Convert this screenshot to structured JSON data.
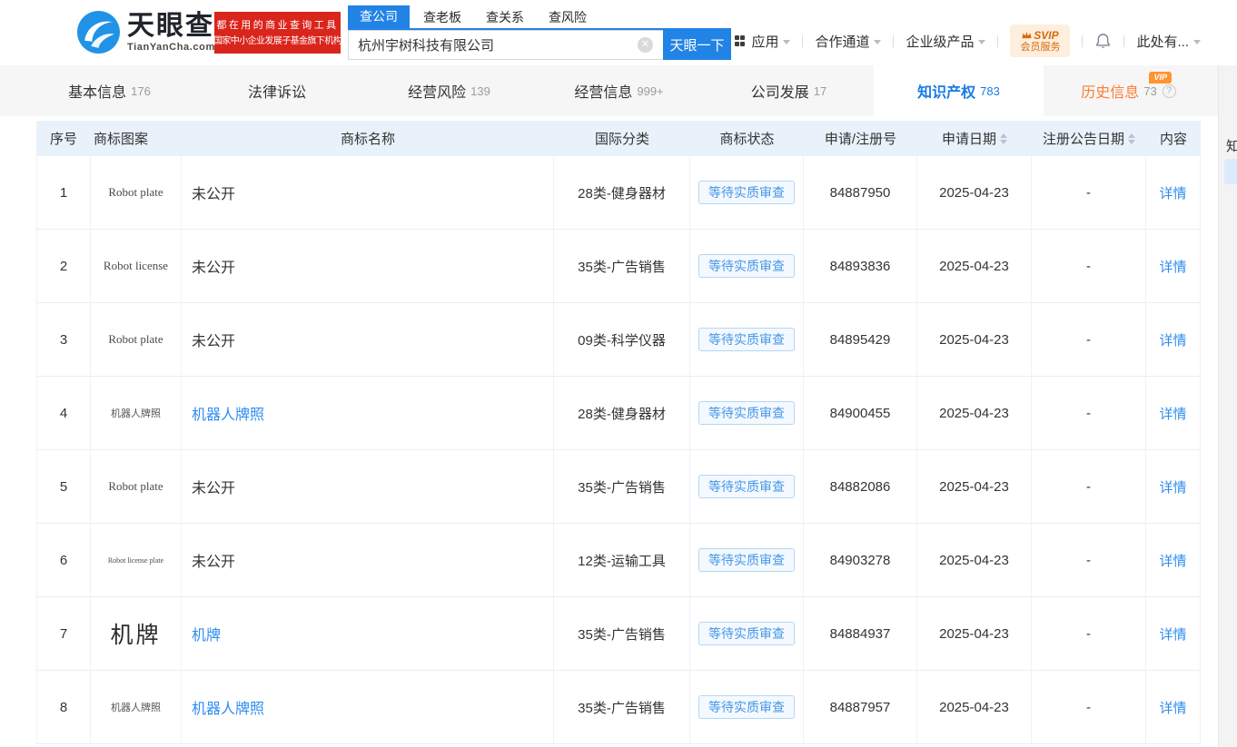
{
  "colors": {
    "brand_blue": "#2183e6",
    "link_blue": "#2d8cf0",
    "active_tab_blue": "#1a7be5",
    "promo_red": "#da251c",
    "vip_orange": "#ff9432",
    "history_orange": "#ff7c33",
    "table_header_bg": "#e9f2fb",
    "status_badge_blue": "#4796e8"
  },
  "header": {
    "logo": {
      "brand": "天眼查",
      "domain": "TianYanCha.com"
    },
    "promo": {
      "line1": "都在用的商业查询工具",
      "line2": "国家中小企业发展子基金旗下机构"
    },
    "search": {
      "tabs": [
        {
          "label": "查公司"
        },
        {
          "label": "查老板"
        },
        {
          "label": "查关系"
        },
        {
          "label": "查风险"
        }
      ],
      "active_tab": "查公司",
      "value": "杭州宇树科技有限公司",
      "button": "天眼一下"
    },
    "nav": {
      "apps": "应用",
      "partner": "合作通道",
      "enterprise": "企业级产品",
      "more": "此处有..."
    },
    "svip": {
      "top": "SVIP",
      "bottom": "会员服务"
    }
  },
  "vip_text": "VIP",
  "help_glyph": "?",
  "active_tab": "知识产权",
  "tabs": [
    {
      "label": "基本信息",
      "count": "176"
    },
    {
      "label": "法律诉讼",
      "count": ""
    },
    {
      "label": "经营风险",
      "count": "139"
    },
    {
      "label": "经营信息",
      "count": "999+"
    },
    {
      "label": "公司发展",
      "count": "17"
    },
    {
      "label": "知识产权",
      "count": "783"
    },
    {
      "label": "历史信息",
      "count": "73",
      "highlight": true,
      "vip": true,
      "help": true
    }
  ],
  "side_anchor": "知",
  "table": {
    "columns": [
      {
        "label": "序号"
      },
      {
        "label": "商标图案"
      },
      {
        "label": "商标名称"
      },
      {
        "label": "国际分类"
      },
      {
        "label": "商标状态"
      },
      {
        "label": "申请/注册号"
      },
      {
        "label": "申请日期",
        "sortable": true
      },
      {
        "label": "注册公告日期",
        "sortable": true
      },
      {
        "label": "内容"
      }
    ],
    "rows": [
      {
        "no": "1",
        "image": "Robot plate",
        "image_style": "latin",
        "name": "未公开",
        "name_is_link": false,
        "intl_class": "28类-健身器材",
        "status": "等待实质审查",
        "reg_no": "84887950",
        "apply_date": "2025-04-23",
        "pub_date": "-",
        "detail": "详情"
      },
      {
        "no": "2",
        "image": "Robot license",
        "image_style": "latin",
        "name": "未公开",
        "name_is_link": false,
        "intl_class": "35类-广告销售",
        "status": "等待实质审查",
        "reg_no": "84893836",
        "apply_date": "2025-04-23",
        "pub_date": "-",
        "detail": "详情"
      },
      {
        "no": "3",
        "image": "Robot plate",
        "image_style": "latin",
        "name": "未公开",
        "name_is_link": false,
        "intl_class": "09类-科学仪器",
        "status": "等待实质审查",
        "reg_no": "84895429",
        "apply_date": "2025-04-23",
        "pub_date": "-",
        "detail": "详情"
      },
      {
        "no": "4",
        "image": "机器人牌照",
        "image_style": "cn-small",
        "name": "机器人牌照",
        "name_is_link": true,
        "intl_class": "28类-健身器材",
        "status": "等待实质审查",
        "reg_no": "84900455",
        "apply_date": "2025-04-23",
        "pub_date": "-",
        "detail": "详情"
      },
      {
        "no": "5",
        "image": "Robot plate",
        "image_style": "latin",
        "name": "未公开",
        "name_is_link": false,
        "intl_class": "35类-广告销售",
        "status": "等待实质审查",
        "reg_no": "84882086",
        "apply_date": "2025-04-23",
        "pub_date": "-",
        "detail": "详情"
      },
      {
        "no": "6",
        "image": "Robot license plate",
        "image_style": "latin-tiny",
        "name": "未公开",
        "name_is_link": false,
        "intl_class": "12类-运输工具",
        "status": "等待实质审查",
        "reg_no": "84903278",
        "apply_date": "2025-04-23",
        "pub_date": "-",
        "detail": "详情"
      },
      {
        "no": "7",
        "image": "机牌",
        "image_style": "cn-large",
        "name": "机牌",
        "name_is_link": true,
        "intl_class": "35类-广告销售",
        "status": "等待实质审查",
        "reg_no": "84884937",
        "apply_date": "2025-04-23",
        "pub_date": "-",
        "detail": "详情"
      },
      {
        "no": "8",
        "image": "机器人牌照",
        "image_style": "cn-small",
        "name": "机器人牌照",
        "name_is_link": true,
        "intl_class": "35类-广告销售",
        "status": "等待实质审查",
        "reg_no": "84887957",
        "apply_date": "2025-04-23",
        "pub_date": "-",
        "detail": "详情"
      }
    ]
  }
}
